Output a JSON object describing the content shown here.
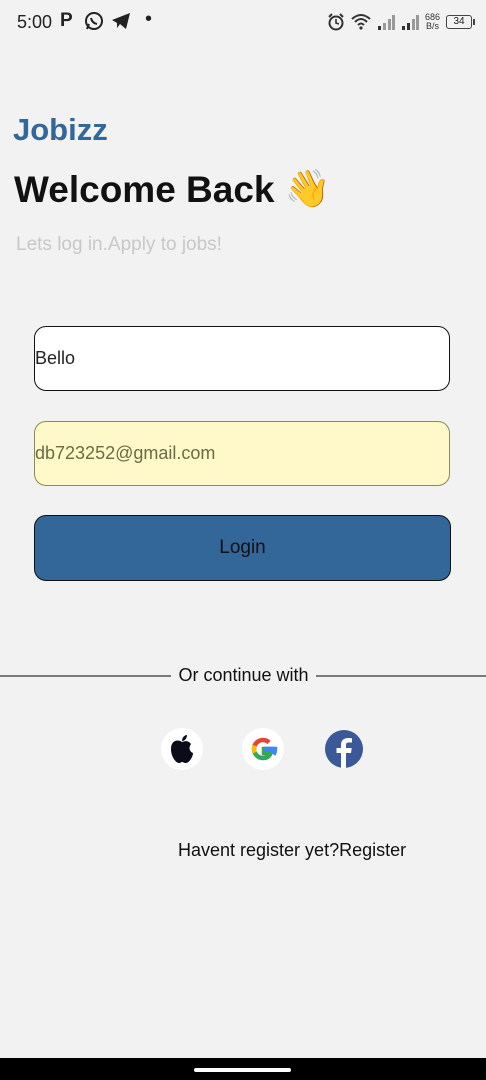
{
  "status_bar": {
    "time": "5:00",
    "net_speed_value": "686",
    "net_speed_unit": "B/s",
    "battery": "34",
    "icons": [
      "p-app-icon",
      "whatsapp-icon",
      "telegram-icon",
      "notification-dot-icon",
      "alarm-icon",
      "wifi-icon",
      "signal-icon",
      "signal-icon",
      "battery-icon"
    ]
  },
  "brand": "Jobizz",
  "heading": {
    "title": "Welcome Back",
    "emoji": "👋"
  },
  "subtitle": "Lets log in.Apply to jobs!",
  "form": {
    "name_value": "Bello",
    "email_value": "db723252@gmail.com",
    "login_label": "Login"
  },
  "divider_text": "Or continue with",
  "social": [
    "apple-icon",
    "google-icon",
    "facebook-icon"
  ],
  "register": {
    "prompt": "Havent register yet?",
    "link": "Register"
  },
  "colors": {
    "brand": "#336699",
    "background": "#f2f2f2",
    "autofill": "#fff8c8",
    "facebook": "#3b5998"
  }
}
